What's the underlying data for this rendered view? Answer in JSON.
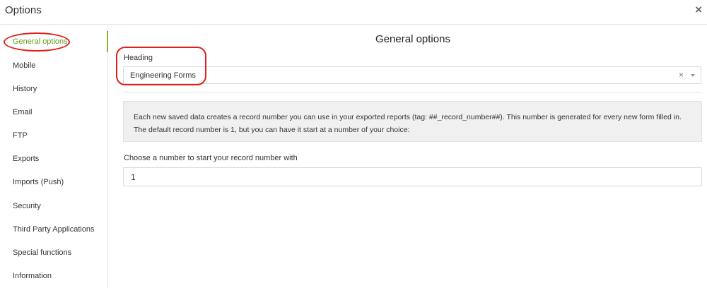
{
  "window": {
    "title": "Options",
    "close_label": "×"
  },
  "sidebar": {
    "items": [
      {
        "label": "General options",
        "active": true
      },
      {
        "label": "Mobile"
      },
      {
        "label": "History"
      },
      {
        "label": "Email"
      },
      {
        "label": "FTP"
      },
      {
        "label": "Exports"
      },
      {
        "label": "Imports (Push)"
      },
      {
        "label": "Security"
      },
      {
        "label": "Third Party Applications"
      },
      {
        "label": "Special functions"
      },
      {
        "label": "Information"
      }
    ]
  },
  "main": {
    "title": "General options",
    "heading": {
      "label": "Heading",
      "value": "Engineering Forms",
      "clear_label": "×"
    },
    "info_text": "Each new saved data creates a record number you can use in your exported reports (tag: ##_record_number##). This number is generated for every new form filled in. The default record number is 1, but you can have it start at a number of your choice:",
    "record_number": {
      "label": "Choose a number to start your record number with",
      "value": "1"
    }
  },
  "colors": {
    "accent": "#8bb23f",
    "active_text": "#6a9a1f",
    "annotation": "#e0201c"
  }
}
